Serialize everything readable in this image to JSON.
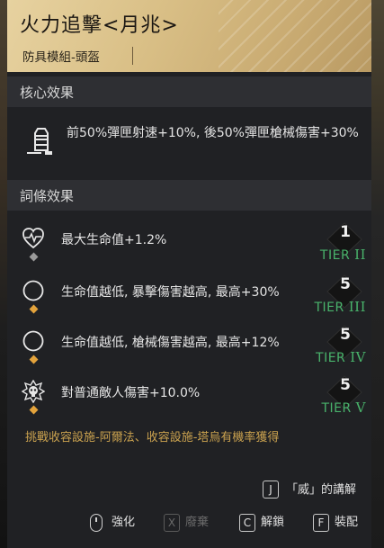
{
  "header": {
    "title": "火力追擊<月兆>",
    "subtitle": "防具模組-頭盔"
  },
  "core": {
    "heading": "核心效果",
    "description": "前50%彈匣射速+10%, 後50%彈匣槍械傷害+30%",
    "icon": "bullet-icon"
  },
  "traits": {
    "heading": "詞條效果",
    "items": [
      {
        "icon": "heart-pulse-icon",
        "text": "最大生命值+1.2%",
        "tier_value": "1",
        "tier_prefix": "TIER ",
        "tier_roman": "II",
        "rarity_color": "#9a9a9a"
      },
      {
        "icon": "moon-icon",
        "text": "生命值越低, 暴擊傷害越高, 最高+30%",
        "tier_value": "5",
        "tier_prefix": "TIER ",
        "tier_roman": "III",
        "rarity_color": "#e3a33c"
      },
      {
        "icon": "moon-icon",
        "text": "生命值越低, 槍械傷害越高, 最高+12%",
        "tier_value": "5",
        "tier_prefix": "TIER ",
        "tier_roman": "IV",
        "rarity_color": "#e3a33c"
      },
      {
        "icon": "skull-burst-icon",
        "text": "對普通敵人傷害+10.0%",
        "tier_value": "5",
        "tier_prefix": "TIER ",
        "tier_roman": "V",
        "rarity_color": "#e3a33c"
      }
    ]
  },
  "source_text": "挑戰收容設施-阿爾法、收容設施-塔烏有機率獲得",
  "hint": {
    "key": "J",
    "label": "「威」的講解"
  },
  "actions": [
    {
      "key": "mouse",
      "label": "強化",
      "enabled": true
    },
    {
      "key": "X",
      "label": "廢棄",
      "enabled": false
    },
    {
      "key": "C",
      "label": "解鎖",
      "enabled": true
    },
    {
      "key": "F",
      "label": "裝配",
      "enabled": true
    }
  ],
  "colors": {
    "accent": "#d9bf86",
    "tier_green": "#49b36b",
    "source_gold": "#caa24f"
  }
}
